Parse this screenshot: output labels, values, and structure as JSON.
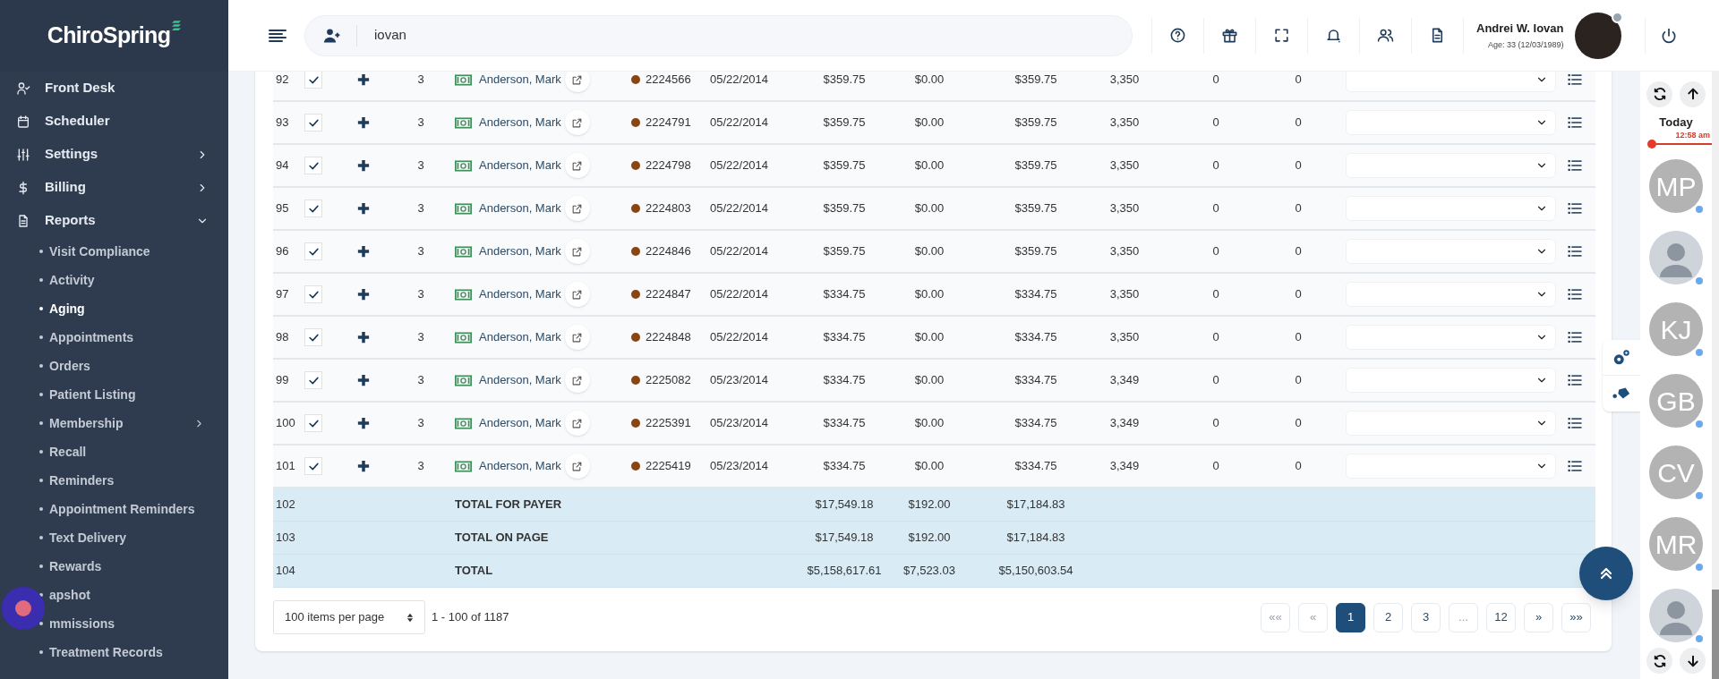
{
  "sidebar": {
    "logo": "ChiroSpring",
    "items": [
      {
        "label": "Front Desk"
      },
      {
        "label": "Scheduler"
      },
      {
        "label": "Settings",
        "expanded": false
      },
      {
        "label": "Billing",
        "expanded": false
      },
      {
        "label": "Reports",
        "expanded": true,
        "children": [
          {
            "label": "Visit Compliance",
            "selected": false
          },
          {
            "label": "Activity",
            "selected": false
          },
          {
            "label": "Aging",
            "selected": true
          },
          {
            "label": "Appointments",
            "selected": false
          },
          {
            "label": "Orders",
            "selected": false
          },
          {
            "label": "Patient Listing",
            "selected": false
          },
          {
            "label": "Membership",
            "selected": false,
            "expanded": false
          },
          {
            "label": "Recall",
            "selected": false
          },
          {
            "label": "Reminders",
            "selected": false
          },
          {
            "label": "Appointment Reminders",
            "selected": false
          },
          {
            "label": "Text Delivery",
            "selected": false
          },
          {
            "label": "Rewards",
            "selected": false
          },
          {
            "label": "apshot",
            "selected": false
          },
          {
            "label": "mmissions",
            "selected": false
          },
          {
            "label": "Treatment Records",
            "selected": false
          }
        ]
      }
    ]
  },
  "header": {
    "search_value": "iovan",
    "user": {
      "name": "Andrei W. Iovan",
      "age": "Age: 33 (12/03/1989)"
    }
  },
  "table": {
    "rows": [
      {
        "num": "92",
        "checked": true,
        "qty": "3",
        "patient": "Anderson, Mark",
        "color": "#8b4513",
        "claim": "2224566",
        "date": "05/22/2014",
        "billed": "$359.75",
        "paid": "$0.00",
        "balance": "$359.75",
        "column_10": "3,350",
        "column_11": "0",
        "column_12": "0"
      },
      {
        "num": "93",
        "checked": true,
        "qty": "3",
        "patient": "Anderson, Mark",
        "color": "#8b4513",
        "claim": "2224791",
        "date": "05/22/2014",
        "billed": "$359.75",
        "paid": "$0.00",
        "balance": "$359.75",
        "column_10": "3,350",
        "column_11": "0",
        "column_12": "0"
      },
      {
        "num": "94",
        "checked": true,
        "qty": "3",
        "patient": "Anderson, Mark",
        "color": "#8b4513",
        "claim": "2224798",
        "date": "05/22/2014",
        "billed": "$359.75",
        "paid": "$0.00",
        "balance": "$359.75",
        "column_10": "3,350",
        "column_11": "0",
        "column_12": "0"
      },
      {
        "num": "95",
        "checked": true,
        "qty": "3",
        "patient": "Anderson, Mark",
        "color": "#8b4513",
        "claim": "2224803",
        "date": "05/22/2014",
        "billed": "$359.75",
        "paid": "$0.00",
        "balance": "$359.75",
        "column_10": "3,350",
        "column_11": "0",
        "column_12": "0"
      },
      {
        "num": "96",
        "checked": true,
        "qty": "3",
        "patient": "Anderson, Mark",
        "color": "#8b4513",
        "claim": "2224846",
        "date": "05/22/2014",
        "billed": "$359.75",
        "paid": "$0.00",
        "balance": "$359.75",
        "column_10": "3,350",
        "column_11": "0",
        "column_12": "0"
      },
      {
        "num": "97",
        "checked": true,
        "qty": "3",
        "patient": "Anderson, Mark",
        "color": "#8b4513",
        "claim": "2224847",
        "date": "05/22/2014",
        "billed": "$334.75",
        "paid": "$0.00",
        "balance": "$334.75",
        "column_10": "3,350",
        "column_11": "0",
        "column_12": "0"
      },
      {
        "num": "98",
        "checked": true,
        "qty": "3",
        "patient": "Anderson, Mark",
        "color": "#8b4513",
        "claim": "2224848",
        "date": "05/22/2014",
        "billed": "$334.75",
        "paid": "$0.00",
        "balance": "$334.75",
        "column_10": "3,350",
        "column_11": "0",
        "column_12": "0"
      },
      {
        "num": "99",
        "checked": true,
        "qty": "3",
        "patient": "Anderson, Mark",
        "color": "#8b4513",
        "claim": "2225082",
        "date": "05/23/2014",
        "billed": "$334.75",
        "paid": "$0.00",
        "balance": "$334.75",
        "column_10": "3,349",
        "column_11": "0",
        "column_12": "0"
      },
      {
        "num": "100",
        "checked": true,
        "qty": "3",
        "patient": "Anderson, Mark",
        "color": "#8b4513",
        "claim": "2225391",
        "date": "05/23/2014",
        "billed": "$334.75",
        "paid": "$0.00",
        "balance": "$334.75",
        "column_10": "3,349",
        "column_11": "0",
        "column_12": "0"
      },
      {
        "num": "101",
        "checked": true,
        "qty": "3",
        "patient": "Anderson, Mark",
        "color": "#8b4513",
        "claim": "2225419",
        "date": "05/23/2014",
        "billed": "$334.75",
        "paid": "$0.00",
        "balance": "$334.75",
        "column_10": "3,349",
        "column_11": "0",
        "column_12": "0"
      }
    ],
    "totals": [
      {
        "num": "102",
        "label": "TOTAL FOR PAYER",
        "billed": "$17,549.18",
        "paid": "$192.00",
        "balance": "$17,184.83"
      },
      {
        "num": "103",
        "label": "TOTAL ON PAGE",
        "billed": "$17,549.18",
        "paid": "$192.00",
        "balance": "$17,184.83"
      },
      {
        "num": "104",
        "label": "TOTAL",
        "billed": "$5,158,617.61",
        "paid": "$7,523.03",
        "balance": "$5,150,603.54"
      }
    ]
  },
  "pagination": {
    "per_page": "100 items per page",
    "range": "1 - 100 of 1187",
    "pages": [
      {
        "label": "««",
        "selected": false,
        "disabled": true
      },
      {
        "label": "«",
        "selected": false,
        "disabled": true
      },
      {
        "label": "1",
        "selected": true,
        "disabled": false
      },
      {
        "label": "2",
        "selected": false,
        "disabled": false
      },
      {
        "label": "3",
        "selected": false,
        "disabled": false
      },
      {
        "label": "...",
        "selected": false,
        "disabled": true
      },
      {
        "label": "12",
        "selected": false,
        "disabled": false
      },
      {
        "label": "»",
        "selected": false,
        "disabled": false
      },
      {
        "label": "»»",
        "selected": false,
        "disabled": false
      }
    ]
  },
  "rail": {
    "day": "Today",
    "time": "12:58 am",
    "providers": [
      {
        "kind": "initials",
        "initials": "MP"
      },
      {
        "kind": "photo"
      },
      {
        "kind": "initials",
        "initials": "KJ"
      },
      {
        "kind": "initials",
        "initials": "GB"
      },
      {
        "kind": "initials",
        "initials": "CV"
      },
      {
        "kind": "initials",
        "initials": "MR"
      },
      {
        "kind": "photo"
      }
    ]
  }
}
